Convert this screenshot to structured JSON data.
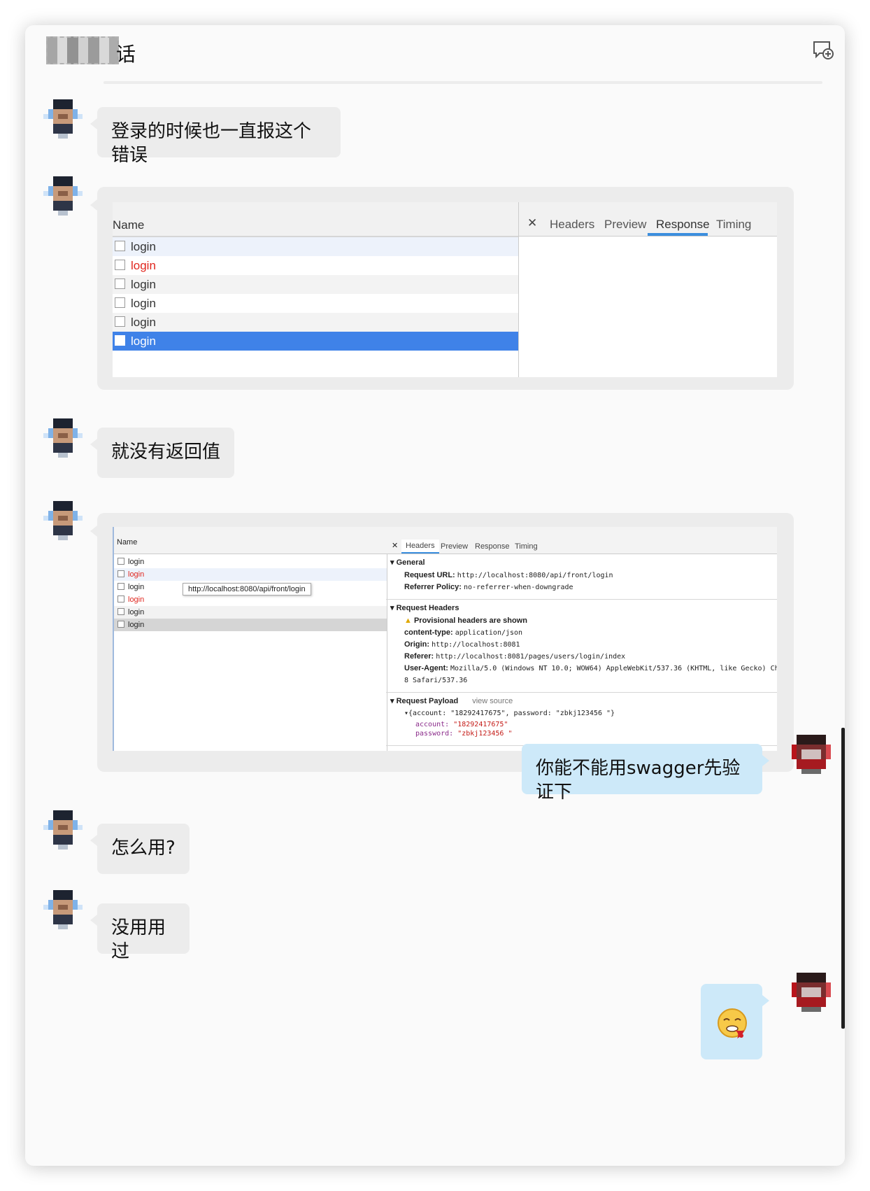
{
  "chat": {
    "title_visible": "话",
    "compose_icon": "new-message-icon"
  },
  "messages": [
    {
      "text": "登录的时候也一直报这个错误"
    },
    {
      "text": "就没有返回值"
    },
    {
      "text": "你能不能用swagger先验证下"
    },
    {
      "text": "怎么用?"
    },
    {
      "text": "没用用过"
    },
    {
      "emoji": "🤮"
    }
  ],
  "screenshot1": {
    "name_header": "Name",
    "close_glyph": "✕",
    "tabs": [
      "Headers",
      "Preview",
      "Response",
      "Timing"
    ],
    "active_tab": "Response",
    "rows": [
      "login",
      "login",
      "login",
      "login",
      "login",
      "login"
    ],
    "error_row_color": "#e0261e",
    "selected_color": "#3f82e8"
  },
  "screenshot2": {
    "name_header": "Name",
    "close_glyph": "✕",
    "tabs": [
      "Headers",
      "Preview",
      "Response",
      "Timing"
    ],
    "active_tab": "Headers",
    "rows": [
      "login",
      "login",
      "login",
      "login",
      "login",
      "login"
    ],
    "tooltip": "http://localhost:8080/api/front/login",
    "general": {
      "title": "General",
      "request_url_label": "Request URL:",
      "request_url": "http://localhost:8080/api/front/login",
      "referrer_policy_label": "Referrer Policy:",
      "referrer_policy": "no-referrer-when-downgrade"
    },
    "request_headers": {
      "title": "Request Headers",
      "warning": "Provisional headers are shown",
      "content_type_label": "content-type:",
      "content_type": "application/json",
      "origin_label": "Origin:",
      "origin": "http://localhost:8081",
      "referer_label": "Referer:",
      "referer": "http://localhost:8081/pages/users/login/index",
      "user_agent_label": "User-Agent:",
      "user_agent": "Mozilla/5.0 (Windows NT 10.0; WOW64) AppleWebKit/537.36 (KHTML, like Gecko) Chrom",
      "user_agent_cont": "8 Safari/537.36"
    },
    "payload": {
      "title": "Request Payload",
      "view_source": "view source",
      "summary": "{account: \"18292417675\", password: \"zbkj123456 \"}",
      "account_key": "account:",
      "account_value": "\"18292417675\"",
      "password_key": "password:",
      "password_value": "\"zbkj123456 \""
    }
  }
}
